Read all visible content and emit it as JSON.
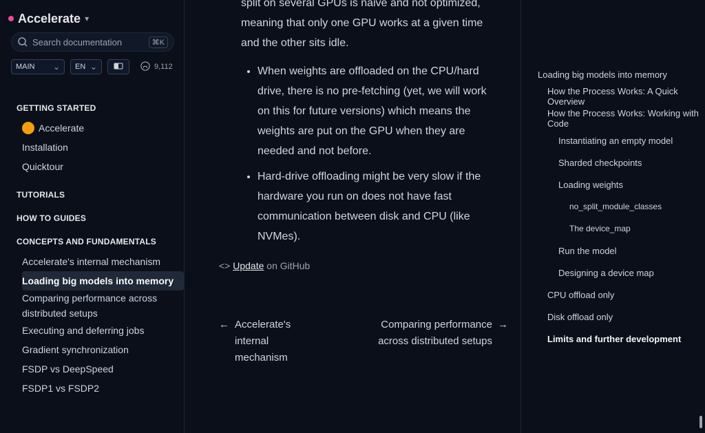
{
  "sidebar": {
    "brand": "Accelerate",
    "search_placeholder": "Search documentation",
    "search_hotkey": "⌘K",
    "select_main": "MAIN",
    "select_lang": "EN",
    "stars": "9,112",
    "sections": {
      "getting_started": "GETTING STARTED",
      "tutorials": "TUTORIALS",
      "how_to": "HOW TO GUIDES",
      "concepts": "CONCEPTS AND FUNDAMENTALS"
    },
    "getting_started_items": [
      "Accelerate",
      "Installation",
      "Quicktour"
    ],
    "concepts_items": [
      "Accelerate's internal mechanism",
      "Loading big models into memory",
      "Comparing performance across distributed setups",
      "Executing and deferring jobs",
      "Gradient synchronization",
      "FSDP vs DeepSpeed",
      "FSDP1 vs FSDP2"
    ]
  },
  "content": {
    "para1": "split on several GPUs is naive and not optimized, meaning that only one GPU works at a given time and the other sits idle.",
    "bullet1": "When weights are offloaded on the CPU/hard drive, there is no pre-fetching (yet, we will work on this for future versions) which means the weights are put on the GPU when they are needed and not before.",
    "bullet2": "Hard-drive offloading might be very slow if the hardware you run on does not have fast communication between disk and CPU (like NVMes).",
    "edit_link": "Update",
    "edit_suffix": "on GitHub",
    "prev_label": "Accelerate's internal mechanism",
    "next_label": "Comparing performance across distributed setups"
  },
  "toc": [
    {
      "label": "Loading big models into memory",
      "level": 1,
      "bold": false
    },
    {
      "label": "How the Process Works: A Quick Overview",
      "level": 2,
      "bold": false
    },
    {
      "label": "How the Process Works: Working with Code",
      "level": 2,
      "bold": false
    },
    {
      "label": "Instantiating an empty model",
      "level": 3,
      "bold": false
    },
    {
      "label": "Sharded checkpoints",
      "level": 3,
      "bold": false
    },
    {
      "label": "Loading weights",
      "level": 3,
      "bold": false
    },
    {
      "label": "no_split_module_classes",
      "level": 4,
      "bold": false
    },
    {
      "label": "The device_map",
      "level": 4,
      "bold": false
    },
    {
      "label": "Run the model",
      "level": 3,
      "bold": false
    },
    {
      "label": "Designing a device map",
      "level": 3,
      "bold": false
    },
    {
      "label": "CPU offload only",
      "level": 2,
      "bold": false
    },
    {
      "label": "Disk offload only",
      "level": 2,
      "bold": false
    },
    {
      "label": "Limits and further development",
      "level": 2,
      "bold": true
    }
  ],
  "colors": {
    "bg": "#0b0f19",
    "accent": "#ec4899",
    "text": "#d1d5db",
    "muted": "#9ca3af"
  },
  "icons": {
    "search": "search-icon",
    "chevron": "chevron-down-icon",
    "github": "github-icon",
    "arrow_left": "arrow-left-icon",
    "arrow_right": "arrow-right-icon",
    "code": "code-icon",
    "theme": "theme-icon"
  }
}
